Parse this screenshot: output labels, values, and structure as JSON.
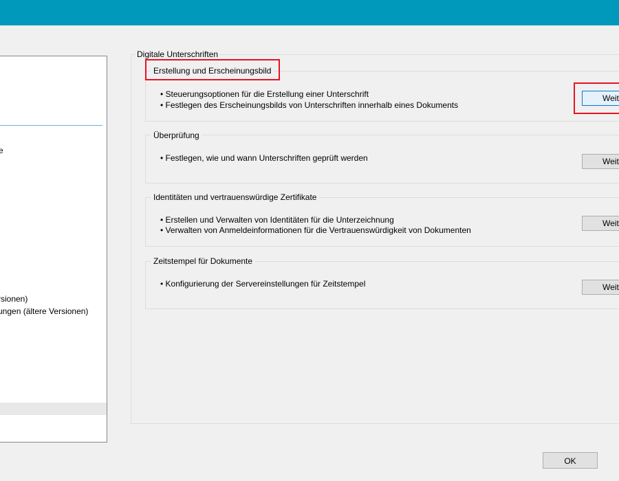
{
  "left_list": {
    "items": [
      "e",
      "rsionen)",
      "ungen (ältere Versionen)"
    ]
  },
  "group": {
    "legend": "Digitale Unterschriften",
    "sections": [
      {
        "title": "Erstellung und Erscheinungsbild",
        "bullets": [
          "• Steuerungsoptionen für die Erstellung einer Unterschrift",
          "• Festlegen des Erscheinungsbilds von Unterschriften innerhalb eines Dokuments"
        ],
        "button": "Weit"
      },
      {
        "title": "Überprüfung",
        "bullets": [
          "• Festlegen, wie und wann Unterschriften geprüft werden"
        ],
        "button": "Weit"
      },
      {
        "title": "Identitäten und vertrauenswürdige Zertifikate",
        "bullets": [
          "• Erstellen und Verwalten von Identitäten für die Unterzeichnung",
          "• Verwalten von Anmeldeinformationen für die Vertrauenswürdigkeit von Dokumenten"
        ],
        "button": "Weit"
      },
      {
        "title": "Zeitstempel für Dokumente",
        "bullets": [
          "• Konfigurierung der Servereinstellungen für Zeitstempel"
        ],
        "button": "Weit"
      }
    ]
  },
  "footer": {
    "ok_label": "OK"
  },
  "colors": {
    "titlebar": "#0099bc",
    "highlight": "#e81123",
    "focus": "#0078d7"
  }
}
